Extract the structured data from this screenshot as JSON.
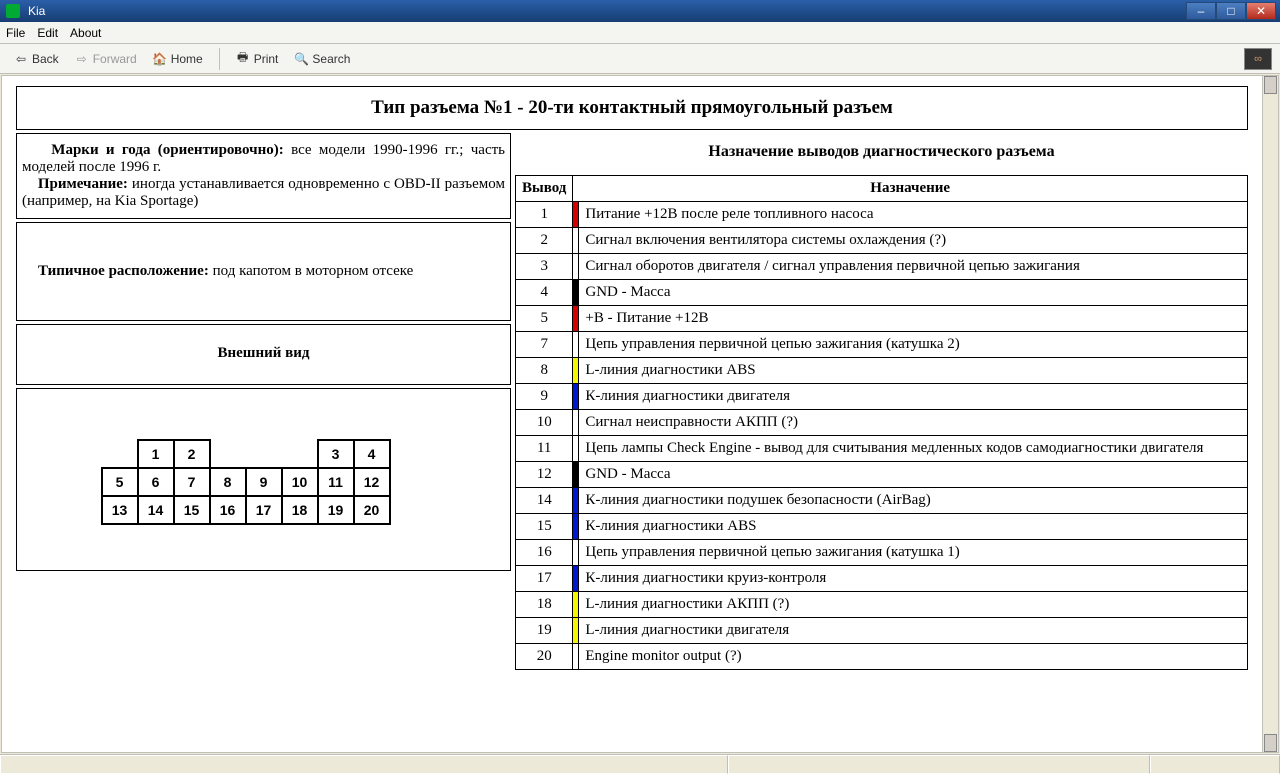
{
  "window": {
    "title": "Kia"
  },
  "menu": {
    "file": "File",
    "edit": "Edit",
    "about": "About"
  },
  "toolbar": {
    "back": "Back",
    "forward": "Forward",
    "home": "Home",
    "print": "Print",
    "search": "Search"
  },
  "page": {
    "heading": "Тип разъема №1 - 20-ти контактный прямоугольный разъем",
    "brands_label": "Марки и года (ориентировочно):",
    "brands_text": " все модели 1990-1996 гг.; часть моделей после 1996 г.",
    "note_label": "Примечание:",
    "note_text": " иногда устанавливается одновременно с OBD-II разъемом (например, на Kia Sportage)",
    "location_label": "Типичное расположение:",
    "location_text": " под капотом в моторном отсеке",
    "appearance_label": "Внешний вид",
    "connector_rows": [
      [
        "",
        "1",
        "2",
        "",
        "",
        "",
        "3",
        "4",
        ""
      ],
      [
        "5",
        "6",
        "7",
        "8",
        "9",
        "10",
        "11",
        "12"
      ],
      [
        "13",
        "14",
        "15",
        "16",
        "17",
        "18",
        "19",
        "20"
      ]
    ],
    "pin_caption": "Назначение выводов диагностического разъема",
    "pin_h1": "Вывод",
    "pin_h2": "Назначение",
    "colors": {
      "red": "#d40000",
      "black": "#000000",
      "blue": "#0017d1",
      "yellow": "#f6f600"
    },
    "pins": [
      {
        "num": "1",
        "color": "red",
        "desc": "Питание +12В после реле топливного насоса"
      },
      {
        "num": "2",
        "color": "",
        "desc": "Сигнал включения вентилятора системы охлаждения (?)"
      },
      {
        "num": "3",
        "color": "",
        "desc": "Сигнал оборотов двигателя / сигнал управления первичной цепью зажигания"
      },
      {
        "num": "4",
        "color": "black",
        "desc": "GND - Масса"
      },
      {
        "num": "5",
        "color": "red",
        "desc": "+B - Питание +12В"
      },
      {
        "num": "7",
        "color": "",
        "desc": "Цепь управления первичной цепью зажигания (катушка 2)"
      },
      {
        "num": "8",
        "color": "yellow",
        "desc": "L-линия диагностики ABS"
      },
      {
        "num": "9",
        "color": "blue",
        "desc": "К-линия диагностики двигателя"
      },
      {
        "num": "10",
        "color": "",
        "desc": "Сигнал неисправности АКПП (?)"
      },
      {
        "num": "11",
        "color": "",
        "desc": "Цепь лампы Check Engine - вывод для считывания медленных кодов самодиагностики двигателя"
      },
      {
        "num": "12",
        "color": "black",
        "desc": "GND - Масса"
      },
      {
        "num": "14",
        "color": "blue",
        "desc": "К-линия диагностики подушек безопасности (AirBag)"
      },
      {
        "num": "15",
        "color": "blue",
        "desc": "К-линия диагностики ABS"
      },
      {
        "num": "16",
        "color": "",
        "desc": "Цепь управления первичной цепью зажигания (катушка 1)"
      },
      {
        "num": "17",
        "color": "blue",
        "desc": "К-линия диагностики круиз-контроля"
      },
      {
        "num": "18",
        "color": "yellow",
        "desc": "L-линия диагностики АКПП (?)"
      },
      {
        "num": "19",
        "color": "yellow",
        "desc": "L-линия диагностики двигателя"
      },
      {
        "num": "20",
        "color": "",
        "desc": "Engine monitor output (?)"
      }
    ]
  }
}
